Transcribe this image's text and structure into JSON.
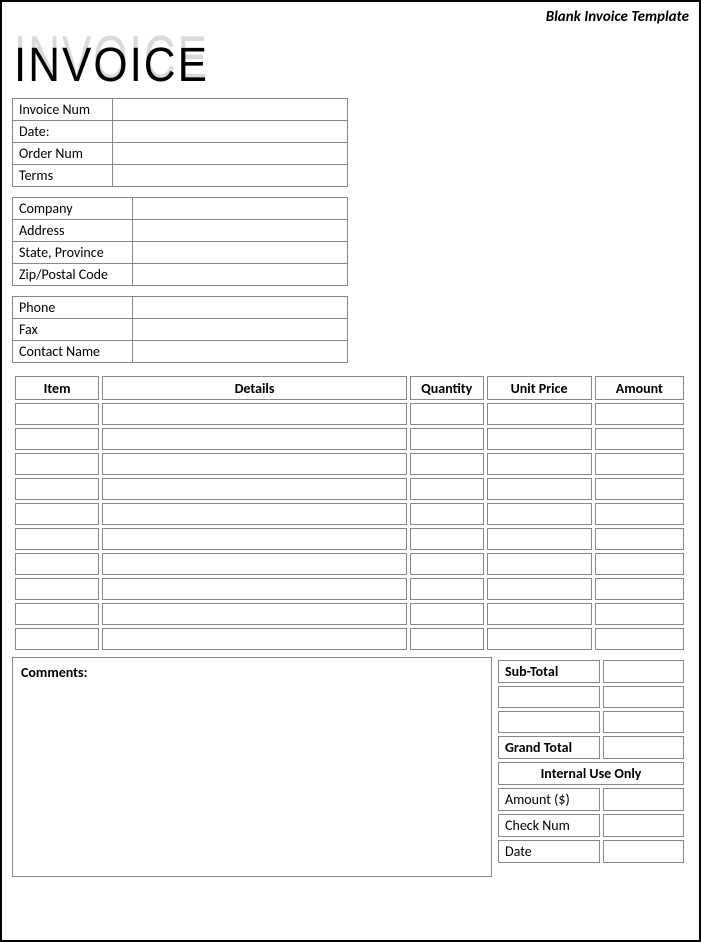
{
  "top_label": "Blank Invoice Template",
  "logo_text": "INVOICE",
  "info1": {
    "rows": [
      {
        "label": "Invoice Num",
        "value": ""
      },
      {
        "label": "Date:",
        "value": ""
      },
      {
        "label": "Order Num",
        "value": ""
      },
      {
        "label": "Terms",
        "value": ""
      }
    ]
  },
  "info2": {
    "rows": [
      {
        "label": "Company",
        "value": ""
      },
      {
        "label": "Address",
        "value": ""
      },
      {
        "label": "State, Province",
        "value": ""
      },
      {
        "label": "Zip/Postal Code",
        "value": ""
      }
    ]
  },
  "info3": {
    "rows": [
      {
        "label": "Phone",
        "value": ""
      },
      {
        "label": "Fax",
        "value": ""
      },
      {
        "label": "Contact Name",
        "value": ""
      }
    ]
  },
  "items": {
    "headers": {
      "item": "Item",
      "details": "Details",
      "quantity": "Quantity",
      "unit_price": "Unit Price",
      "amount": "Amount"
    },
    "rows": [
      {
        "item": "",
        "details": "",
        "quantity": "",
        "unit_price": "",
        "amount": ""
      },
      {
        "item": "",
        "details": "",
        "quantity": "",
        "unit_price": "",
        "amount": ""
      },
      {
        "item": "",
        "details": "",
        "quantity": "",
        "unit_price": "",
        "amount": ""
      },
      {
        "item": "",
        "details": "",
        "quantity": "",
        "unit_price": "",
        "amount": ""
      },
      {
        "item": "",
        "details": "",
        "quantity": "",
        "unit_price": "",
        "amount": ""
      },
      {
        "item": "",
        "details": "",
        "quantity": "",
        "unit_price": "",
        "amount": ""
      },
      {
        "item": "",
        "details": "",
        "quantity": "",
        "unit_price": "",
        "amount": ""
      },
      {
        "item": "",
        "details": "",
        "quantity": "",
        "unit_price": "",
        "amount": ""
      },
      {
        "item": "",
        "details": "",
        "quantity": "",
        "unit_price": "",
        "amount": ""
      },
      {
        "item": "",
        "details": "",
        "quantity": "",
        "unit_price": "",
        "amount": ""
      }
    ]
  },
  "comments_label": "Comments:",
  "totals": {
    "subtotal_label": "Sub-Total",
    "subtotal_value": "",
    "extra1_label": "",
    "extra1_value": "",
    "extra2_label": "",
    "extra2_value": "",
    "grandtotal_label": "Grand Total",
    "grandtotal_value": "",
    "internal_header": "Internal Use Only",
    "amount_label": "Amount ($)",
    "amount_value": "",
    "check_label": "Check Num",
    "check_value": "",
    "date_label": "Date",
    "date_value": ""
  }
}
